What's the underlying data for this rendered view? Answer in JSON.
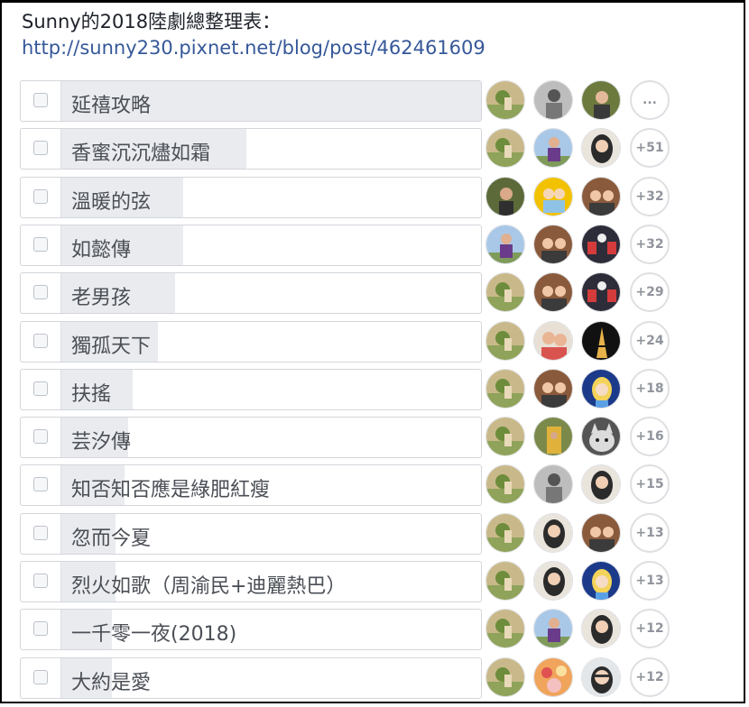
{
  "header": {
    "title": "Sunny的2018陸劇總整理表：",
    "link": "http://sunny230.pixnet.net/blog/post/462461609"
  },
  "colors": {
    "link": "#365899",
    "bar": "#e9ebee",
    "border": "#d3d6db",
    "more_text": "#90949c"
  },
  "poll": {
    "options": [
      {
        "label": "延禧攻略",
        "share": 1.0,
        "more": "...",
        "avatars": [
          "landscape-avatar",
          "gray-person-avatar",
          "portrait-avatar"
        ]
      },
      {
        "label": "香蜜沉沉燼如霜",
        "share": 0.44,
        "more": "+51",
        "avatars": [
          "landscape-avatar",
          "purple-top-avatar",
          "woman-portrait-avatar"
        ]
      },
      {
        "label": "溫暖的弦",
        "share": 0.29,
        "more": "+32",
        "avatars": [
          "woman-outdoor-avatar",
          "yellow-kids-avatar",
          "family-avatar"
        ]
      },
      {
        "label": "如懿傳",
        "share": 0.29,
        "more": "+32",
        "avatars": [
          "purple-top-avatar",
          "family-avatar",
          "tunnel-avatar"
        ]
      },
      {
        "label": "老男孩",
        "share": 0.27,
        "more": "+29",
        "avatars": [
          "landscape-avatar",
          "family-avatar",
          "tunnel-avatar"
        ]
      },
      {
        "label": "獨孤天下",
        "share": 0.23,
        "more": "+24",
        "avatars": [
          "landscape-avatar",
          "couple-avatar",
          "eiffel-tower-avatar"
        ]
      },
      {
        "label": "扶搖",
        "share": 0.17,
        "more": "+18",
        "avatars": [
          "landscape-avatar",
          "family-avatar",
          "cartoon-girl-avatar"
        ]
      },
      {
        "label": "芸汐傳",
        "share": 0.16,
        "more": "+16",
        "avatars": [
          "landscape-avatar",
          "yellow-door-avatar",
          "cat-avatar"
        ]
      },
      {
        "label": "知否知否應是綠肥紅瘦",
        "share": 0.15,
        "more": "+15",
        "avatars": [
          "landscape-avatar",
          "gray-person-avatar",
          "woman-portrait-avatar"
        ]
      },
      {
        "label": "忽而今夏",
        "share": 0.13,
        "more": "+13",
        "avatars": [
          "landscape-avatar",
          "woman-portrait-avatar",
          "family-avatar"
        ]
      },
      {
        "label": "烈火如歌（周渝民+迪麗熱巴）",
        "share": 0.13,
        "more": "+13",
        "avatars": [
          "landscape-avatar",
          "woman-portrait-avatar",
          "cartoon-girl-avatar"
        ]
      },
      {
        "label": "一千零一夜(2018)",
        "share": 0.12,
        "more": "+12",
        "avatars": [
          "landscape-avatar",
          "purple-top-avatar",
          "woman-portrait-avatar"
        ]
      },
      {
        "label": "大約是愛",
        "share": 0.12,
        "more": "+12",
        "avatars": [
          "landscape-avatar",
          "cake-avatar",
          "glasses-woman-avatar"
        ]
      }
    ]
  }
}
